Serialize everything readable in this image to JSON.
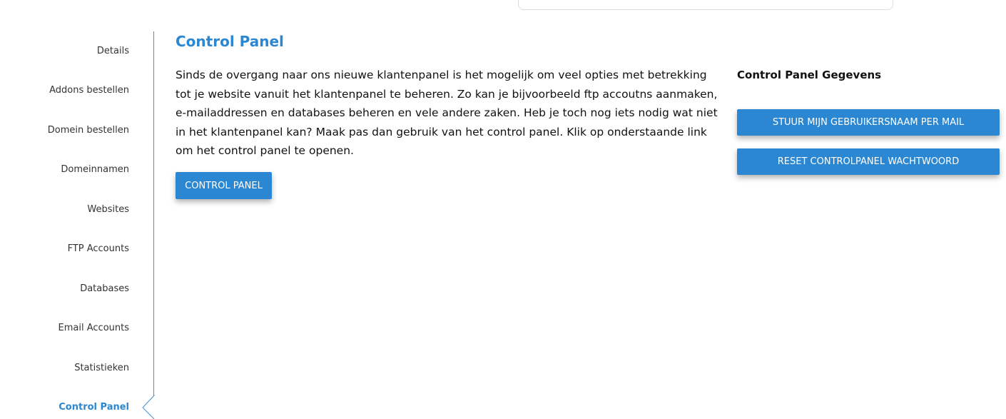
{
  "sidebar": {
    "items": [
      "Details",
      "Addons bestellen",
      "Domein bestellen",
      "Domeinnamen",
      "Websites",
      "FTP Accounts",
      "Databases",
      "Email Accounts",
      "Statistieken",
      "Control Panel"
    ],
    "active": "Control Panel"
  },
  "main": {
    "title": "Control Panel",
    "description": "Sinds de overgang naar ons nieuwe klantenpanel is het mogelijk om veel opties met betrekking tot je website vanuit het klantenpanel te beheren. Zo kan je bijvoorbeeld ftp accoutns aanmaken, e-mailaddressen en databases beheren en vele andere zaken. Heb je toch nog iets nodig wat niet in het klantenpanel kan? Maak pas dan gebruik van het control panel. Klik op onderstaande link om het control panel te openen.",
    "button": "CONTROL PANEL"
  },
  "details": {
    "title": "Control Panel Gegevens",
    "send_username": "STUUR MIJN GEBRUIKERSNAAM PER MAIL",
    "reset_password": "RESET CONTROLPANEL WACHTWOORD"
  },
  "colors": {
    "accent": "#2b87d1"
  }
}
